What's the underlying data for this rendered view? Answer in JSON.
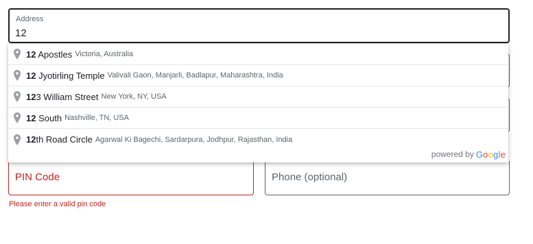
{
  "address": {
    "label": "Address",
    "value": "12"
  },
  "suggestions": [
    {
      "match": "12",
      "rest": " Apostles",
      "secondary": "Victoria, Australia"
    },
    {
      "match": "12",
      "rest": " Jyotirling Temple",
      "secondary": "Valivali Gaon, Manjarli, Badlapur, Maharashtra, India"
    },
    {
      "match": "12",
      "rest": "3 William Street",
      "secondary": "New York, NY, USA"
    },
    {
      "match": "12",
      "rest": " South",
      "secondary": "Nashville, TN, USA"
    },
    {
      "match": "12",
      "rest": "th Road Circle",
      "secondary": "Agarwal Ki Bagechi, Sardarpura, Jodhpur, Rajasthan, India"
    }
  ],
  "attribution": {
    "powered_by": "powered by",
    "google_letters": [
      "G",
      "o",
      "o",
      "g",
      "l",
      "e"
    ]
  },
  "pin_code": {
    "placeholder": "PIN Code",
    "error": "Please enter a valid pin code"
  },
  "phone": {
    "placeholder": "Phone (optional)"
  },
  "colors": {
    "error": "#c5221f",
    "pin_icon": "#9aa0a6",
    "google_blue": "#4285f4",
    "google_red": "#ea4335",
    "google_yellow": "#fbbc05",
    "google_green": "#34a853"
  },
  "icons": {
    "suggestion": "map-pin-icon"
  }
}
